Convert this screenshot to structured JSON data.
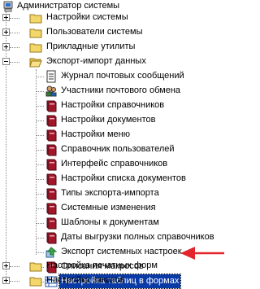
{
  "tree": {
    "root": {
      "label": "Администратор системы",
      "icon": "admin-computer-icon"
    },
    "top_nodes": [
      {
        "label": "Настройки системы",
        "icon": "folder-icon",
        "expanded": false
      },
      {
        "label": "Пользователи системы",
        "icon": "folder-icon",
        "expanded": false
      },
      {
        "label": "Прикладные утилиты",
        "icon": "folder-icon",
        "expanded": false
      },
      {
        "label": "Экспорт-импорт данных",
        "icon": "folder-open-icon",
        "expanded": true
      }
    ],
    "export_children": [
      {
        "label": "Журнал почтовых сообщений",
        "icon": "document-icon"
      },
      {
        "label": "Участники почтового обмена",
        "icon": "users-icon"
      },
      {
        "label": "Настройки справочников",
        "icon": "book-icon"
      },
      {
        "label": "Настройки документов",
        "icon": "book-icon"
      },
      {
        "label": "Настройки меню",
        "icon": "book-icon"
      },
      {
        "label": "Справочник пользователей",
        "icon": "book-icon"
      },
      {
        "label": "Интерфейс справочников",
        "icon": "book-icon"
      },
      {
        "label": "Настройки списка документов",
        "icon": "book-icon"
      },
      {
        "label": "Типы  экспорта-импорта",
        "icon": "book-icon"
      },
      {
        "label": "Системные изменения",
        "icon": "book-icon"
      },
      {
        "label": "Шаблоны к документам",
        "icon": "book-icon"
      },
      {
        "label": "Даты выгрузки полных справочников",
        "icon": "book-icon"
      },
      {
        "label": "Экспорт системных настроек",
        "icon": "export-settings-icon"
      },
      {
        "label": "Описания макросов",
        "icon": "book-icon"
      },
      {
        "label": "Настройка таблиц в формах",
        "icon": "table-list-icon",
        "selected": true
      }
    ],
    "bottom_nodes": [
      {
        "label": "Настройка печатных форм",
        "icon": "folder-icon",
        "expanded": false
      },
      {
        "label": "Настройка заказов",
        "icon": "folder-icon",
        "expanded": false
      }
    ]
  },
  "annotation": {
    "arrow_color": "#e3242b"
  },
  "colors": {
    "selection": "#0a3aa6",
    "folder": "#f4d76b",
    "book": "#a3162a"
  }
}
